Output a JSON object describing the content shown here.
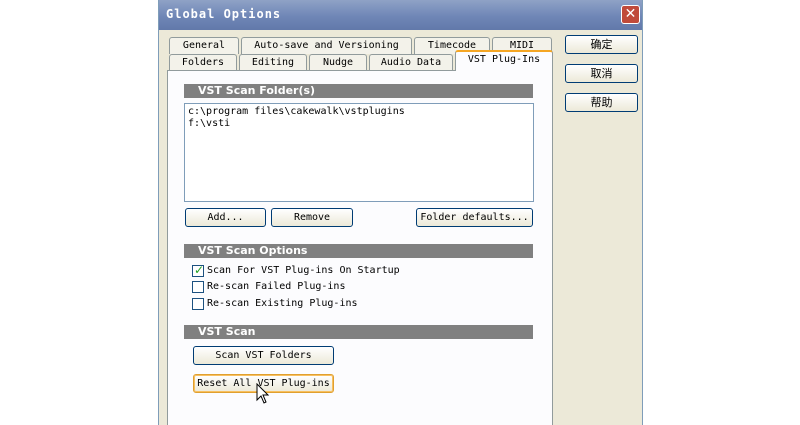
{
  "window": {
    "title": "Global Options",
    "close_glyph": "✕"
  },
  "tabs_row1": [
    "General",
    "Auto-save and Versioning",
    "Timecode",
    "MIDI"
  ],
  "tabs_row2": [
    "Folders",
    "Editing",
    "Nudge",
    "Audio Data",
    "VST Plug-Ins"
  ],
  "active_tab": "VST Plug-Ins",
  "side_buttons": {
    "ok": "确定",
    "cancel": "取消",
    "help": "帮助"
  },
  "scan_folders": {
    "heading": "VST Scan Folder(s)",
    "items": [
      "c:\\program files\\cakewalk\\vstplugins",
      "f:\\vsti"
    ],
    "add_label": "Add...",
    "remove_label": "Remove",
    "defaults_label": "Folder defaults..."
  },
  "scan_options": {
    "heading": "VST Scan Options",
    "options": [
      {
        "label": "Scan For VST Plug-ins On Startup",
        "checked": true
      },
      {
        "label": "Re-scan Failed Plug-ins",
        "checked": false
      },
      {
        "label": "Re-scan Existing Plug-ins",
        "checked": false
      }
    ]
  },
  "scan": {
    "heading": "VST Scan",
    "scan_label": "Scan VST Folders",
    "reset_label": "Reset All VST Plug-ins"
  },
  "colors": {
    "title_bar": "#7188b8",
    "close": "#c04a3a",
    "active_tab_accent": "#f5a623",
    "section_header": "#808080",
    "check": "#21a121"
  },
  "icons": {
    "close": "close-icon",
    "checkmark": "checkmark-icon",
    "cursor": "mouse-pointer-icon"
  }
}
